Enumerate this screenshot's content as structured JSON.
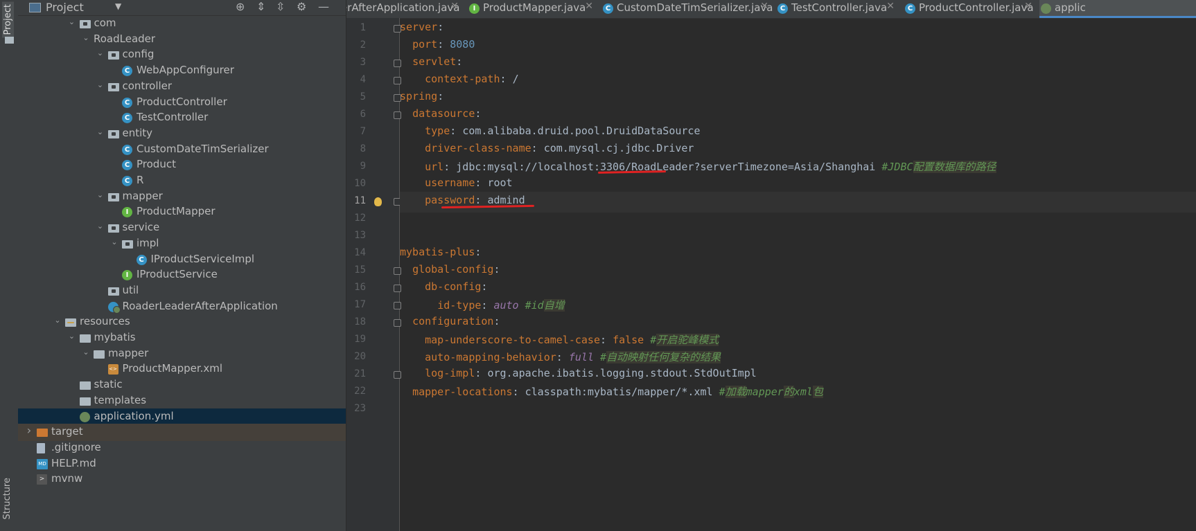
{
  "side_strip": {
    "project_label": "Project",
    "structure_label": "Structure"
  },
  "project_panel": {
    "title": "Project",
    "tree": [
      {
        "label": "com",
        "depth": 5,
        "icon": "folder",
        "expanded": true
      },
      {
        "label": "RoadLeader",
        "depth": 6,
        "icon": "none",
        "expanded": true
      },
      {
        "label": "config",
        "depth": 7,
        "icon": "folder",
        "expanded": true
      },
      {
        "label": "WebAppConfigurer",
        "depth": 8,
        "icon": "class"
      },
      {
        "label": "controller",
        "depth": 7,
        "icon": "folder",
        "expanded": true
      },
      {
        "label": "ProductController",
        "depth": 8,
        "icon": "class"
      },
      {
        "label": "TestController",
        "depth": 8,
        "icon": "class"
      },
      {
        "label": "entity",
        "depth": 7,
        "icon": "folder",
        "expanded": true
      },
      {
        "label": "CustomDateTimSerializer",
        "depth": 8,
        "icon": "class"
      },
      {
        "label": "Product",
        "depth": 8,
        "icon": "class"
      },
      {
        "label": "R",
        "depth": 8,
        "icon": "class"
      },
      {
        "label": "mapper",
        "depth": 7,
        "icon": "folder",
        "expanded": true
      },
      {
        "label": "ProductMapper",
        "depth": 8,
        "icon": "interface"
      },
      {
        "label": "service",
        "depth": 7,
        "icon": "folder",
        "expanded": true
      },
      {
        "label": "impl",
        "depth": 8,
        "icon": "folder",
        "expanded": true
      },
      {
        "label": "IProductServiceImpl",
        "depth": 9,
        "icon": "class"
      },
      {
        "label": "IProductService",
        "depth": 8,
        "icon": "interface"
      },
      {
        "label": "util",
        "depth": 7,
        "icon": "folder"
      },
      {
        "label": "RoaderLeaderAfterApplication",
        "depth": 7,
        "icon": "boot"
      },
      {
        "label": "resources",
        "depth": 4,
        "icon": "resources",
        "expanded": true
      },
      {
        "label": "mybatis",
        "depth": 5,
        "icon": "folder-plain",
        "expanded": true
      },
      {
        "label": "mapper",
        "depth": 6,
        "icon": "folder-plain",
        "expanded": true
      },
      {
        "label": "ProductMapper.xml",
        "depth": 7,
        "icon": "xml"
      },
      {
        "label": "static",
        "depth": 5,
        "icon": "folder-plain"
      },
      {
        "label": "templates",
        "depth": 5,
        "icon": "folder-plain"
      },
      {
        "label": "application.yml",
        "depth": 5,
        "icon": "yml",
        "selected": true
      },
      {
        "label": "target",
        "depth": 2,
        "icon": "folder-orange",
        "collapsed": true,
        "highlight": true
      },
      {
        "label": ".gitignore",
        "depth": 2,
        "icon": "file"
      },
      {
        "label": "HELP.md",
        "depth": 2,
        "icon": "md"
      },
      {
        "label": "mvnw",
        "depth": 2,
        "icon": "term"
      }
    ]
  },
  "tabs": [
    {
      "label": "LeaderAfterApplication.java",
      "icon": "none"
    },
    {
      "label": "ProductMapper.java",
      "icon": "interface"
    },
    {
      "label": "CustomDateTimSerializer.java",
      "icon": "class"
    },
    {
      "label": "TestController.java",
      "icon": "class"
    },
    {
      "label": "ProductController.java",
      "icon": "class"
    },
    {
      "label": "applic",
      "icon": "yml",
      "active": true
    }
  ],
  "editor": {
    "current_line": 11,
    "lines": [
      [
        [
          "k",
          "server"
        ],
        [
          "p",
          ":"
        ]
      ],
      [
        [
          "s",
          "  "
        ],
        [
          "k",
          "port"
        ],
        [
          "p",
          ": "
        ],
        [
          "n",
          "8080"
        ]
      ],
      [
        [
          "s",
          "  "
        ],
        [
          "k",
          "servlet"
        ],
        [
          "p",
          ":"
        ]
      ],
      [
        [
          "s",
          "    "
        ],
        [
          "k",
          "context-path"
        ],
        [
          "p",
          ": "
        ],
        [
          "v",
          "/"
        ]
      ],
      [
        [
          "k",
          "spring"
        ],
        [
          "p",
          ":"
        ]
      ],
      [
        [
          "s",
          "  "
        ],
        [
          "k",
          "datasource"
        ],
        [
          "p",
          ":"
        ]
      ],
      [
        [
          "s",
          "    "
        ],
        [
          "k",
          "type"
        ],
        [
          "p",
          ": "
        ],
        [
          "v",
          "com.alibaba.druid.pool.DruidDataSource"
        ]
      ],
      [
        [
          "s",
          "    "
        ],
        [
          "k",
          "driver-class-name"
        ],
        [
          "p",
          ": "
        ],
        [
          "v",
          "com.mysql.cj.jdbc.Driver"
        ]
      ],
      [
        [
          "s",
          "    "
        ],
        [
          "k",
          "url"
        ],
        [
          "p",
          ": "
        ],
        [
          "v",
          "jdbc:mysql://localhost:3306/RoadLeader?serverTimezone=Asia/Shanghai "
        ],
        [
          "cm",
          "#JDBC"
        ],
        [
          "cn",
          "配置数据库的路径"
        ]
      ],
      [
        [
          "s",
          "    "
        ],
        [
          "k",
          "username"
        ],
        [
          "p",
          ": "
        ],
        [
          "v",
          "root"
        ]
      ],
      [
        [
          "s",
          "    "
        ],
        [
          "k",
          "password"
        ],
        [
          "p",
          ": "
        ],
        [
          "v",
          "admind"
        ]
      ],
      [],
      [],
      [
        [
          "k",
          "mybatis-plus"
        ],
        [
          "p",
          ":"
        ]
      ],
      [
        [
          "s",
          "  "
        ],
        [
          "k",
          "global-config"
        ],
        [
          "p",
          ":"
        ]
      ],
      [
        [
          "s",
          "    "
        ],
        [
          "k",
          "db-config"
        ],
        [
          "p",
          ":"
        ]
      ],
      [
        [
          "s",
          "      "
        ],
        [
          "k",
          "id-type"
        ],
        [
          "p",
          ": "
        ],
        [
          "kw",
          "auto"
        ],
        [
          "cm",
          " #id"
        ],
        [
          "cn",
          "自增"
        ]
      ],
      [
        [
          "s",
          "  "
        ],
        [
          "k",
          "configuration"
        ],
        [
          "p",
          ":"
        ]
      ],
      [
        [
          "s",
          "    "
        ],
        [
          "k",
          "map-underscore-to-camel-case"
        ],
        [
          "p",
          ": "
        ],
        [
          "k",
          "false"
        ],
        [
          "cm",
          " #"
        ],
        [
          "cn",
          "开启驼峰模式"
        ]
      ],
      [
        [
          "s",
          "    "
        ],
        [
          "k",
          "auto-mapping-behavior"
        ],
        [
          "p",
          ": "
        ],
        [
          "kw",
          "full"
        ],
        [
          "cm",
          " #"
        ],
        [
          "cn",
          "自动映射任何复杂的结果"
        ]
      ],
      [
        [
          "s",
          "    "
        ],
        [
          "k",
          "log-impl"
        ],
        [
          "p",
          ": "
        ],
        [
          "v",
          "org.apache.ibatis.logging.stdout.StdOutImpl"
        ]
      ],
      [
        [
          "s",
          "  "
        ],
        [
          "k",
          "mapper-locations"
        ],
        [
          "p",
          ": "
        ],
        [
          "v",
          "classpath:mybatis/mapper/*.xml "
        ],
        [
          "cm",
          "#"
        ],
        [
          "cn",
          "加载"
        ],
        [
          "cm",
          "mapper"
        ],
        [
          "cn",
          "的"
        ],
        [
          "cm",
          "xml"
        ],
        [
          "cn",
          "包"
        ]
      ],
      []
    ]
  }
}
